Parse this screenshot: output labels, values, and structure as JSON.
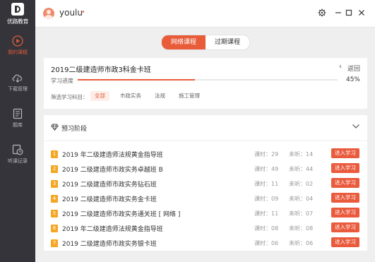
{
  "sidebar": {
    "logo_text": "优路教育",
    "items": [
      {
        "label": "我的课程",
        "icon": "play-circle-icon",
        "active": true
      },
      {
        "label": "下载管理",
        "icon": "cloud-download-icon",
        "active": false
      },
      {
        "label": "题库",
        "icon": "document-icon",
        "active": false
      },
      {
        "label": "听课记录",
        "icon": "history-icon",
        "active": false
      }
    ]
  },
  "titlebar": {
    "username": "youlu",
    "caret": "▾",
    "buttons": [
      "settings",
      "minimize",
      "maximize",
      "close"
    ]
  },
  "tabs": [
    {
      "label": "网络课程",
      "active": true
    },
    {
      "label": "过期课程",
      "active": false
    }
  ],
  "course": {
    "title": "2019二级建造师市政3科金卡班",
    "back_label": "返回",
    "progress_label": "学习进度",
    "progress_percent_text": "45%",
    "progress_value": 45,
    "filter_label": "筛选学习科目：",
    "filters": [
      {
        "label": "全部",
        "active": true
      },
      {
        "label": "市政实务",
        "active": false
      },
      {
        "label": "法规",
        "active": false
      },
      {
        "label": "施工管理",
        "active": false
      }
    ]
  },
  "section": {
    "title": "预习阶段",
    "rows": [
      {
        "num": "1",
        "name": "2019 年二级建造师法规黄金指导班",
        "hours": "课时：29",
        "unheard": "未听：14",
        "button": "进入学习"
      },
      {
        "num": "2",
        "name": "2019 二级建造师市政实务卓越班 B",
        "hours": "课时：49",
        "unheard": "未听：44",
        "button": "进入学习"
      },
      {
        "num": "3",
        "name": "2019 二级建造师市政实务钻石班",
        "hours": "课时：11",
        "unheard": "未听：02",
        "button": "进入学习"
      },
      {
        "num": "4",
        "name": "2019 二级建造师市政实务金卡班",
        "hours": "课时：09",
        "unheard": "未听：04",
        "button": "进入学习"
      },
      {
        "num": "5",
        "name": "2019 二级建造师市政实务通关班 [ 网络 ]",
        "hours": "课时：11",
        "unheard": "未听：07",
        "button": "进入学习"
      },
      {
        "num": "6",
        "name": "2019 年二级建造师法规黄金指导班",
        "hours": "课时：08",
        "unheard": "未听：08",
        "button": "进入学习"
      },
      {
        "num": "7",
        "name": "2019 二级建造师市政实务银卡班",
        "hours": "课时：06",
        "unheard": "未听：06",
        "button": "进入学习"
      }
    ]
  },
  "colors": {
    "accent": "#e85c3a",
    "sidebar_bg": "#34343a",
    "badge": "#f5a623"
  }
}
